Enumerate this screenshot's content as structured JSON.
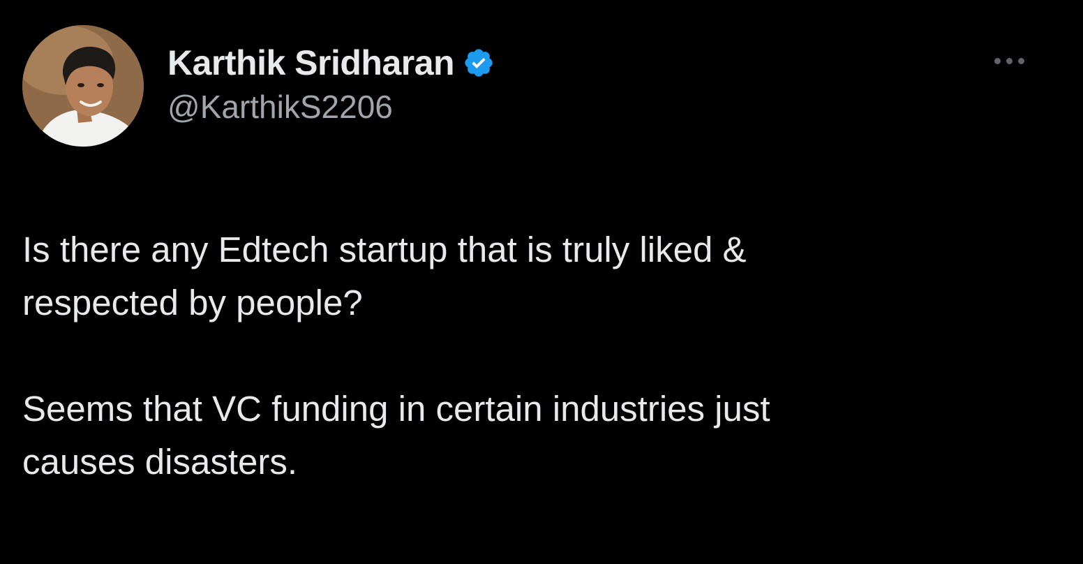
{
  "tweet": {
    "author": {
      "display_name": "Karthik Sridharan",
      "handle": "@KarthikS2206",
      "verified": true,
      "avatar": "avatar-photo"
    },
    "menu_icon": "more-horizontal-icon",
    "paragraphs": [
      "Is there any Edtech startup that is truly liked &\nrespected by people?",
      "Seems that VC funding in certain industries just\ncauses disasters."
    ]
  },
  "colors": {
    "background": "#000000",
    "text_primary": "#e7e9ea",
    "text_secondary": "#a0a6ab",
    "verified_badge": "#1d9bf0"
  }
}
